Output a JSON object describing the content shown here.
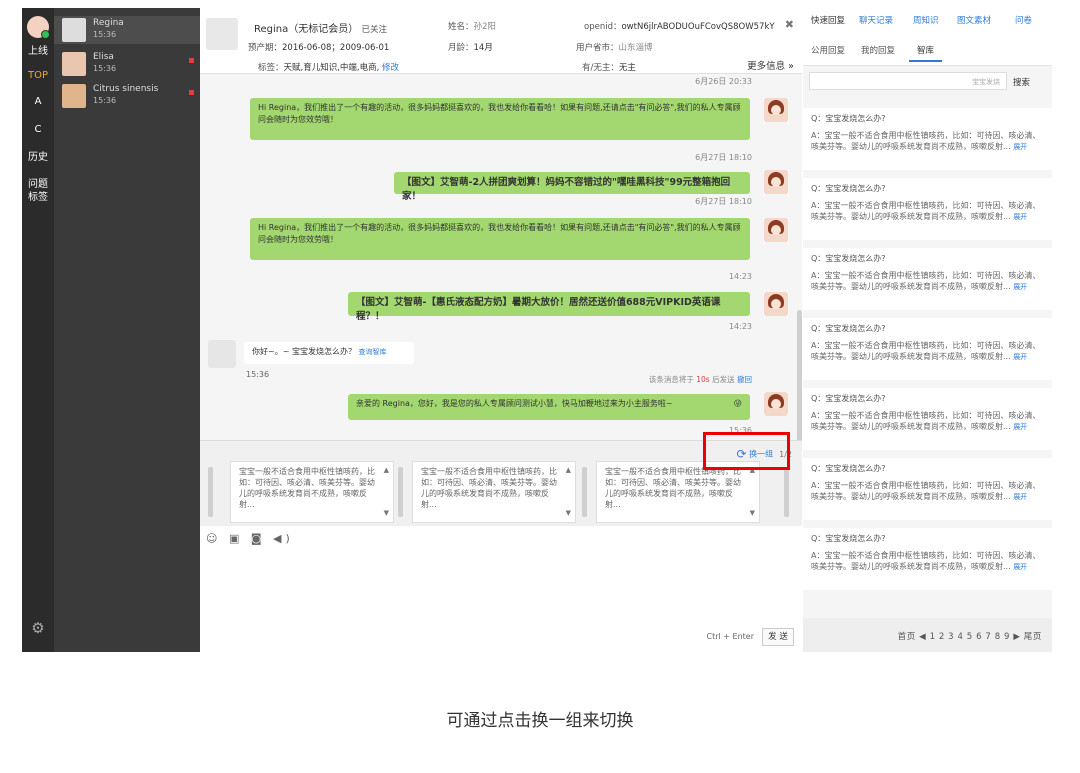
{
  "rail": {
    "items": [
      {
        "label": "上线",
        "top": 0
      },
      {
        "label": "TOP"
      },
      {
        "label": "A"
      },
      {
        "label": "C"
      },
      {
        "label": "历史"
      },
      {
        "label": "问题"
      },
      {
        "label": "标签"
      }
    ]
  },
  "contacts": [
    {
      "name": "Regina",
      "time": "15:36"
    },
    {
      "name": "Elisa",
      "time": "15:36"
    },
    {
      "name": "Citrus sinensis",
      "time": "15:36"
    }
  ],
  "header": {
    "name": "Regina（无标记会员）",
    "followed": "已关注",
    "due_label": "预产期：",
    "due": "2016-06-08；2009-06-01",
    "tags_label": "标签：",
    "tags": "天赋,育儿知识,中端,电商,",
    "tags_edit": "修改",
    "realname_label": "姓名：",
    "realname": "孙2阳",
    "age_label": "月龄：",
    "age": "14月",
    "openid_label": "openid：",
    "openid": "owtN6jlrABODUOuFCovQS8OW57kY",
    "province_label": "用户省市：",
    "province": "山东淄博",
    "kid_label": "有/无主：",
    "kid": "无主",
    "more": "更多信息 »",
    "close": "✖"
  },
  "messages": {
    "top_time": "6月26日 20:33",
    "m1": "Hi Regina，我们推出了一个有趣的活动，很多妈妈都挺喜欢的，我也发给你看看哈！如果有问题,还请点击\"有问必答\",我们的私人专属顾问会随时为您效劳哦！",
    "t1": "6月27日 18:10",
    "m2": "【图文】艾智萌-2人拼团爽划算！妈妈不容错过的\"嘿哇黑科技\"99元整箱抱回家！",
    "t2": "6月27日 18:10",
    "m3": "Hi Regina，我们推出了一个有趣的活动，很多妈妈都挺喜欢的，我也发给你看看哈！如果有问题,还请点击\"有问必答\",我们的私人专属顾问会随时为您效劳哦！",
    "t3": "14:23",
    "m4": "【图文】艾智萌-【惠氏液态配方奶】暑期大放价！居然还送价值688元VIPKID英语课程？！",
    "t4": "14:23",
    "cust_msg": "你好~。~ 宝宝发烧怎么办？",
    "cust_link": "查询智库",
    "cust_time": "15:36",
    "auto_pre": "该条消息将于",
    "auto_sec": "10s",
    "auto_post": "后发送",
    "auto_cancel": "撤回",
    "m5": "亲爱的 Regina，您好，我是您的私人专属顾问测试小慧，快马加鞭地过来为小主服务啦~",
    "t5": "15:36"
  },
  "suggestions": {
    "refresh": "换一组",
    "page": "1/2",
    "cards": [
      "宝宝一般不适合食用中枢性镇咳药，比如：可待因、咳必清、咳美芬等。婴幼儿的呼吸系统发育尚不成熟，咳嗽反射...",
      "宝宝一般不适合食用中枢性镇咳药，比如：可待因、咳必清、咳美芬等。婴幼儿的呼吸系统发育尚不成熟，咳嗽反射...",
      "宝宝一般不适合食用中枢性镇咳药，比如：可待因、咳必清、咳美芬等。婴幼儿的呼吸系统发育尚不成熟，咳嗽反射..."
    ]
  },
  "input": {
    "tools": "☺ ▣ ◙ ◀)",
    "hint": "Ctrl + Enter",
    "send": "发 送"
  },
  "right": {
    "tabs": [
      "快速回复",
      "聊天记录",
      "周知识",
      "图文素材",
      "问卷"
    ],
    "subtabs": [
      "公用回复",
      "我的回复",
      "智库"
    ],
    "search_placeholder": "宝宝发烧",
    "search_btn": "搜索",
    "qa": [
      {
        "q": "Q：宝宝发烧怎么办?",
        "a": "A：宝宝一般不适合食用中枢性镇咳药，比如：可待因、咳必清、咳美芬等。婴幼儿的呼吸系统发育尚不成熟，咳嗽反射...",
        "more": "展开"
      },
      {
        "q": "Q：宝宝发烧怎么办?",
        "a": "A：宝宝一般不适合食用中枢性镇咳药，比如：可待因、咳必清、咳美芬等。婴幼儿的呼吸系统发育尚不成熟，咳嗽反射...",
        "more": "展开"
      },
      {
        "q": "Q：宝宝发烧怎么办?",
        "a": "A：宝宝一般不适合食用中枢性镇咳药，比如：可待因、咳必清、咳美芬等。婴幼儿的呼吸系统发育尚不成熟，咳嗽反射...",
        "more": "展开"
      },
      {
        "q": "Q：宝宝发烧怎么办?",
        "a": "A：宝宝一般不适合食用中枢性镇咳药，比如：可待因、咳必清、咳美芬等。婴幼儿的呼吸系统发育尚不成熟，咳嗽反射...",
        "more": "展开"
      },
      {
        "q": "Q：宝宝发烧怎么办?",
        "a": "A：宝宝一般不适合食用中枢性镇咳药，比如：可待因、咳必清、咳美芬等。婴幼儿的呼吸系统发育尚不成熟，咳嗽反射...",
        "more": "展开"
      },
      {
        "q": "Q：宝宝发烧怎么办?",
        "a": "A：宝宝一般不适合食用中枢性镇咳药，比如：可待因、咳必清、咳美芬等。婴幼儿的呼吸系统发育尚不成熟，咳嗽反射...",
        "more": "展开"
      },
      {
        "q": "Q：宝宝发烧怎么办?",
        "a": "A：宝宝一般不适合食用中枢性镇咳药，比如：可待因、咳必清、咳美芬等。婴幼儿的呼吸系统发育尚不成熟，咳嗽反射...",
        "more": "展开"
      }
    ],
    "pager": "首页 ◀ 1 2 3 4 5 6 7 8 9 ▶ 尾页"
  },
  "caption": "可通过点击换一组来切换"
}
